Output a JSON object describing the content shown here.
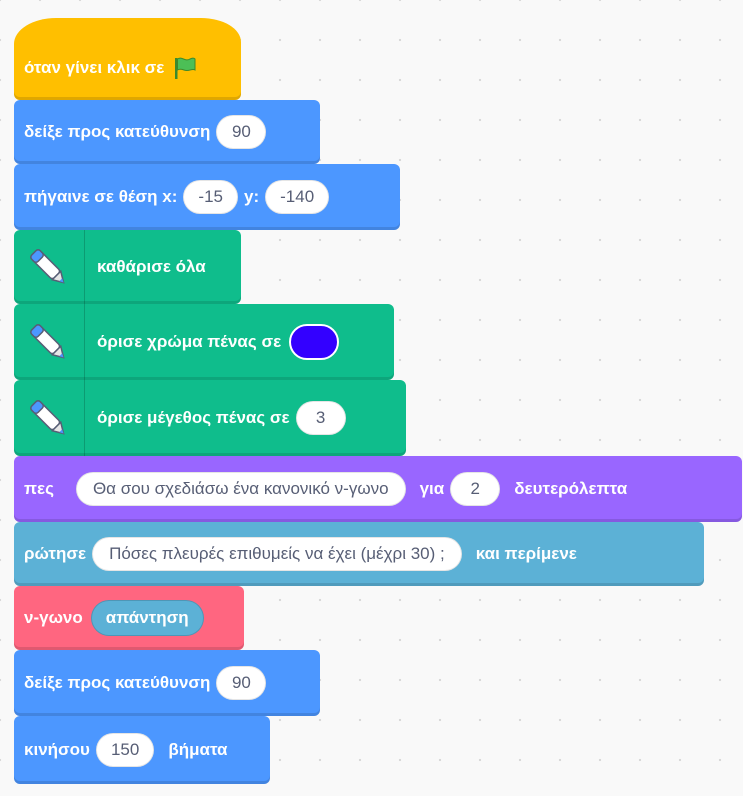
{
  "blocks": {
    "when_flag_clicked": {
      "label": "όταν γίνει κλικ σε",
      "icon": "green-flag-icon"
    },
    "point_direction_1": {
      "label": "δείξε προς κατεύθυνση",
      "value": "90"
    },
    "go_to_xy": {
      "label": "πήγαινε σε θέση x:",
      "x_value": "-15",
      "y_label": "y:",
      "y_value": "-140"
    },
    "pen_clear": {
      "label": "καθάρισε όλα",
      "icon": "pen-icon"
    },
    "set_pen_color": {
      "label": "όρισε χρώμα πένας σε",
      "color": "#3300ff",
      "icon": "pen-icon"
    },
    "set_pen_size": {
      "label": "όρισε μέγεθος πένας σε",
      "value": "3",
      "icon": "pen-icon"
    },
    "say_for_secs": {
      "label": "πες",
      "message": "Θα σου σχεδιάσω ένα κανονικό ν-γωνο",
      "for_label": "για",
      "secs": "2",
      "secs_label": "δευτερόλεπτα"
    },
    "ask_and_wait": {
      "label": "ρώτησε",
      "question": "Πόσες πλευρές επιθυμείς να έχει (μέχρι 30) ;",
      "wait_label": "και περίμενε"
    },
    "set_variable": {
      "label": "ν-γωνο",
      "reporter": "απάντηση"
    },
    "point_direction_2": {
      "label": "δείξε προς κατεύθυνση",
      "value": "90"
    },
    "move_steps": {
      "label": "κινήσου",
      "value": "150",
      "steps_label": "βήματα"
    }
  },
  "colors": {
    "motion": "#4c97ff",
    "events": "#ffbf00",
    "pen": "#0fbd8c",
    "looks": "#9966ff",
    "sensing": "#5cb1d6",
    "variables": "#ff6680"
  }
}
